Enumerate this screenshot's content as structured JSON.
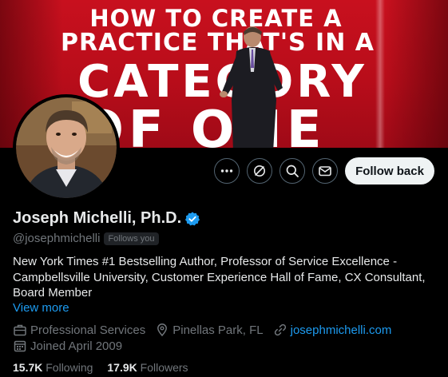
{
  "banner": {
    "line1": "HOW TO CREATE A",
    "line2": "PRACTICE THAT'S IN A",
    "line3": "CATEGORY",
    "line4": "OF ONE"
  },
  "actions": {
    "more": "more-icon",
    "subscribe": "subscribe-icon",
    "search": "search-icon",
    "message": "message-icon",
    "follow_back": "Follow back"
  },
  "profile": {
    "name": "Joseph Michelli, Ph.D.",
    "handle": "@josephmichelli",
    "follows_you": "Follows you",
    "bio": "New York Times #1 Bestselling Author, Professor of Service Excellence - Campbellsville University, Customer Experience Hall of Fame, CX Consultant, Board Member",
    "view_more": "View more",
    "category": "Professional Services",
    "location": "Pinellas Park, FL",
    "website": "josephmichelli.com",
    "joined": "Joined April 2009",
    "following_count": "15.7K",
    "following_label": "Following",
    "followers_count": "17.9K",
    "followers_label": "Followers"
  },
  "colors": {
    "accent": "#1d9bf0",
    "background": "#000000",
    "banner_red": "#c8101e",
    "muted": "#71767b"
  }
}
